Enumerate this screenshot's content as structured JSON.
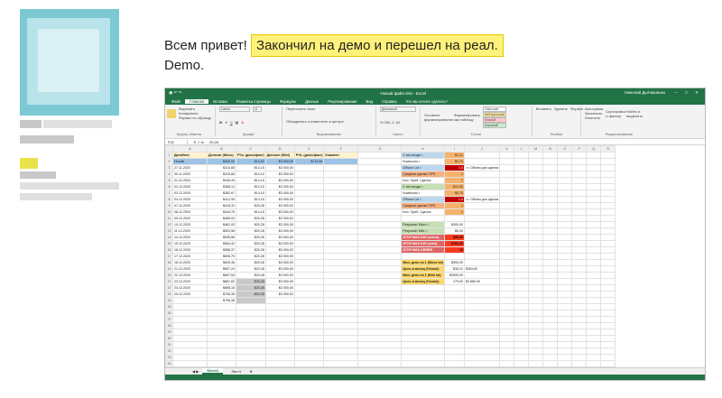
{
  "post": {
    "greeting": "Всем привет!",
    "highlight": "Закончил на демо и перешел на реал.",
    "line2": "Demo."
  },
  "excel": {
    "window_title": "Новый файл.xlsx - Excel",
    "user": "Николай Дьячишенко",
    "tabs": [
      "Файл",
      "Главная",
      "Вставка",
      "Разметка страницы",
      "Формулы",
      "Данные",
      "Рецензирование",
      "Вид",
      "Справка",
      "Что вы хотите сделать?"
    ],
    "active_tab": "Главная",
    "ribbon": {
      "clipboard": "Буфер обмена",
      "paste": "Вставить",
      "cut": "Вырезать",
      "copy": "Копировать",
      "format_painter": "Формат по образцу",
      "font_name": "Calibri",
      "font_size": "11",
      "font": "Шрифт",
      "wrap": "Переносить текст",
      "merge": "Объединить и поместить в центре",
      "alignment": "Выравнивание",
      "number_format": "Денежный",
      "number": "Число",
      "cond_format": "Условное форматирование",
      "format_table": "Форматировать как таблицу",
      "style_normal": "Обычный",
      "style_neutral": "Нейтральный",
      "style_bad": "Плохой",
      "style_good": "Хороший",
      "styles": "Стили",
      "insert": "Вставить",
      "delete": "Удалить",
      "format": "Формат",
      "cells": "Ячейки",
      "autosum": "Автосумма",
      "fill": "Заполнить",
      "clear": "Очистить",
      "sort": "Сортировка и фильтр",
      "find": "Найти и выделить",
      "editing": "Редактирование"
    },
    "formula_bar": {
      "cell": "F22",
      "value": "20,00"
    },
    "columns": [
      "A",
      "B",
      "C",
      "D",
      "E",
      "F",
      "G",
      "H",
      "I",
      "J",
      "K",
      "L",
      "M",
      "N",
      "O",
      "P",
      "Q",
      "R"
    ],
    "headers": [
      "Дата/Item",
      "Депозит (Micro)",
      "P%L (доль/факт)",
      "Депозит (Mini)",
      "P%L (доль/факт)",
      "Коммент"
    ],
    "rows": [
      [
        "Hoodie",
        "$300,00",
        "$14,52",
        "$3 000,00",
        "$176,46",
        ""
      ],
      [
        "27.11.2020",
        "$314,65",
        "$14,15",
        "$3 000,00",
        "",
        ""
      ],
      [
        "30.11.2020",
        "$315,66",
        "$14,15",
        "$3 000,00",
        "",
        ""
      ],
      [
        "01.12.2020",
        "$345,49",
        "$14,15",
        "$3 000,00",
        "",
        ""
      ],
      [
        "02.12.2020",
        "$368,12",
        "$14,15",
        "$3 000,00",
        "",
        ""
      ],
      [
        "03.12.2020",
        "$382,67",
        "$14,15",
        "$3 000,00",
        "",
        ""
      ],
      [
        "04.12.2020",
        "$412,95",
        "$14,15",
        "$3 000,00",
        "",
        ""
      ],
      [
        "07.12.2020",
        "$418,31",
        "$20,28",
        "$3 000,00",
        "",
        ""
      ],
      [
        "08.12.2020",
        "$444,76",
        "$14,15",
        "$3 000,00",
        "",
        ""
      ],
      [
        "09.12.2020",
        "$465,02",
        "$20,28",
        "$3 000,00",
        "",
        ""
      ],
      [
        "10.12.2020",
        "$481,93",
        "$20,28",
        "$3 000,00",
        "",
        ""
      ],
      [
        "11.12.2020",
        "$503,58",
        "$20,28",
        "$3 000,00",
        "",
        ""
      ],
      [
        "14.12.2020",
        "$535,86",
        "$20,28",
        "$3 000,00",
        "",
        ""
      ],
      [
        "15.12.2020",
        "$564,42",
        "$20,28",
        "$3 000,00",
        "",
        ""
      ],
      [
        "16.12.2020",
        "$588,37",
        "$20,28",
        "$3 000,00",
        "",
        ""
      ],
      [
        "17.12.2020",
        "$606,79",
        "$20,28",
        "$3 000,00",
        "",
        ""
      ],
      [
        "18.12.2020",
        "$626,36",
        "$20,28",
        "$3 000,00",
        "",
        ""
      ],
      [
        "21.12.2020",
        "$657,24",
        "$20,28",
        "$3 000,00",
        "",
        ""
      ],
      [
        "22.12.2020",
        "$667,54",
        "$20,28",
        "$3 000,00",
        "",
        ""
      ],
      [
        "23.12.2020",
        "$667,82",
        "$20,28",
        "$3 000,00",
        "",
        ""
      ],
      [
        "24.12.2020",
        "$688,16",
        "$20,28",
        "$3 000,00",
        "",
        ""
      ],
      [
        "25.12.2020",
        "$706,38",
        "$20,28",
        "$3 000,00",
        "",
        ""
      ],
      [
        "",
        "$706,38",
        "",
        "",
        "",
        ""
      ]
    ],
    "side": [
      {
        "label": "1 тип входа =",
        "val": "$1,21",
        "note": "",
        "cls": "lab-b",
        "vcls": "orange"
      },
      {
        "label": "Комиссия =",
        "val": "$0,70",
        "note": "",
        "cls": "",
        "vcls": "orange"
      },
      {
        "label": "Объем  Lot =",
        "val": "1,0",
        "note": "<= Объем для сделок",
        "cls": "lab-b",
        "vcls": "red"
      },
      {
        "label": "Средняя сделка TIPS",
        "val": "1",
        "note": "",
        "cls": "lab-o",
        "vcls": "orange"
      },
      {
        "label": "Кол. Приб. Сделок",
        "val": "1",
        "note": "",
        "cls": "",
        "vcls": "orange"
      },
      {
        "label": "2 тип входа =",
        "val": "$12,00",
        "note": "",
        "cls": "lab-g",
        "vcls": "orange"
      },
      {
        "label": "Комиссия =",
        "val": "$0,70",
        "note": "",
        "cls": "",
        "vcls": "orange"
      },
      {
        "label": "Объем  Lot =",
        "val": "1,0",
        "note": "<= Объем для сделок",
        "cls": "lab-b",
        "vcls": "red"
      },
      {
        "label": "Средняя сделка TIPS",
        "val": "1",
        "note": "",
        "cls": "lab-o",
        "vcls": "orange"
      },
      {
        "label": "Кол. Приб. Сделок",
        "val": "1",
        "note": "",
        "cls": "",
        "vcls": "orange"
      },
      {
        "label": "",
        "val": "",
        "note": "",
        "cls": "",
        "vcls": ""
      },
      {
        "label": "Результат Micro =",
        "val": "$300,00",
        "note": "",
        "cls": "lab-g",
        "vcls": ""
      },
      {
        "label": "Результат Mini =",
        "val": "$0,00",
        "note": "",
        "cls": "lab-g",
        "vcls": ""
      },
      {
        "label": "STOP MAX DAY (micro)",
        "val": "$30,00",
        "note": "",
        "cls": "lab-r",
        "vcls": "redf"
      },
      {
        "label": "STOP MAX DAY (mini)",
        "val": "$102,00",
        "note": "",
        "cls": "lab-r",
        "vcls": "redf"
      },
      {
        "label": "STOP MAX ORDER",
        "val": "10",
        "note": "",
        "cls": "lab-r",
        "vcls": "redf"
      },
      {
        "label": "",
        "val": "",
        "note": "",
        "cls": "",
        "vcls": ""
      },
      {
        "label": "Мин. депо на 1 (Micro lot)",
        "val": "$300,00",
        "note": "",
        "cls": "lab-y",
        "vcls": ""
      },
      {
        "label": "Цель в месяц (%/cash)",
        "val": "$35,22",
        "note": "$363,60",
        "cls": "lab-y",
        "vcls": ""
      },
      {
        "label": "Мин. депо на 1 (Mini lot)",
        "val": "$3000,00",
        "note": "",
        "cls": "lab-y",
        "vcls": ""
      },
      {
        "label": "Цель в месяц (%/cash)",
        "val": "179,00",
        "note": "$3 880,00",
        "cls": "lab-y",
        "vcls": ""
      }
    ],
    "sheet_tabs": [
      "Sheet1",
      "Лист1"
    ],
    "active_sheet": "Sheet1"
  }
}
